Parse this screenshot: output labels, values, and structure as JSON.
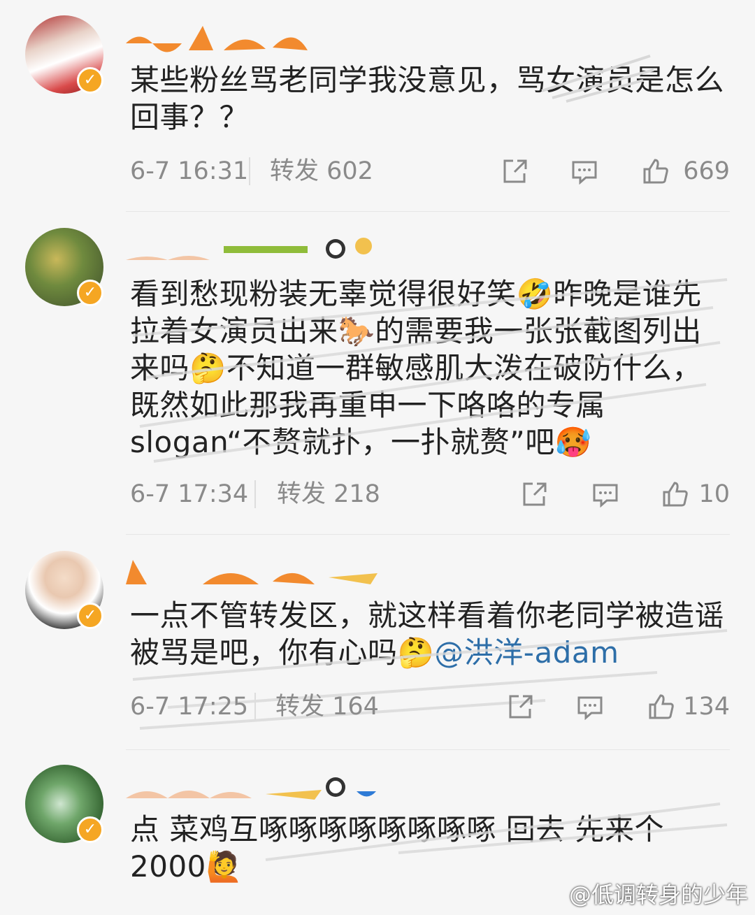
{
  "posts": [
    {
      "text": "某些粉丝骂老同学我没意见，骂女演员是怎么回事？？",
      "time": "6-7 16:31",
      "repost": "转发 602",
      "likes": "669"
    },
    {
      "text": "看到愁现粉装无辜觉得很好笑🤣昨晚是谁先拉着女演员出来🐎的需要我一张张截图列出来吗🤔不知道一群敏感肌大泼在破防什么，既然如此那我再重申一下咯咯的专属slogan“不赘就扑，一扑就赘”吧🥵",
      "time": "6-7 17:34",
      "repost": "转发 218",
      "likes": "10"
    },
    {
      "text": "一点不管转发区，就这样看着你老同学被造谣被骂是吧，你有心吗🤔",
      "mention": "@洪洋-adam",
      "time": "6-7 17:25",
      "repost": "转发 164",
      "likes": "134"
    },
    {
      "text": "点 菜鸡互啄啄啄啄啄啄啄啄 回去 先来个2000🙋",
      "time": "",
      "repost": "",
      "likes": ""
    }
  ],
  "watermark": "@低调转身的少年",
  "icons": [
    "share-icon",
    "comment-icon",
    "like-icon",
    "verified-badge-icon"
  ],
  "colors": {
    "badge": "#f5a623",
    "mention": "#2d6ea8",
    "meta": "#8a8a8a"
  }
}
